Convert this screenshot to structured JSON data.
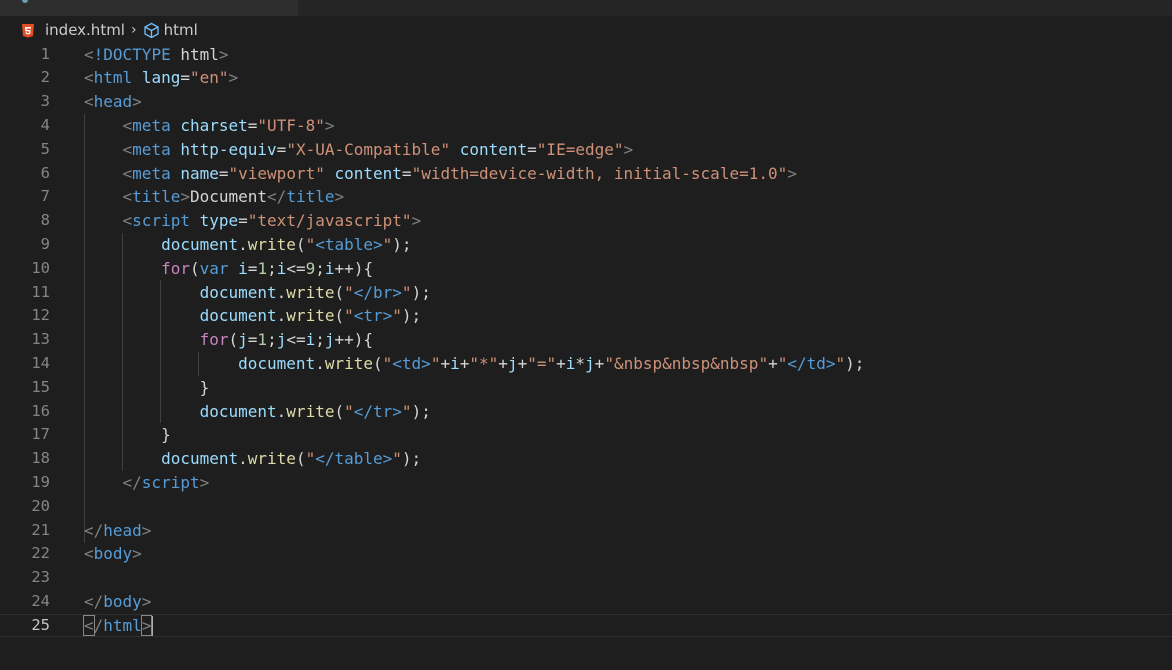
{
  "breadcrumb": {
    "file": "index.html",
    "separator": "›",
    "node": "html",
    "file_icon": "html5-icon",
    "node_icon": "cube-icon"
  },
  "editor": {
    "line_numbers": [
      "1",
      "2",
      "3",
      "4",
      "5",
      "6",
      "7",
      "8",
      "9",
      "10",
      "11",
      "12",
      "13",
      "14",
      "15",
      "16",
      "17",
      "18",
      "19",
      "20",
      "21",
      "22",
      "23",
      "24",
      "25"
    ],
    "current_line": "25",
    "colors": {
      "background": "#1e1e1e",
      "tag": "#569cd6",
      "attribute": "#9cdcfe",
      "string": "#ce9178",
      "function": "#dcdcaa",
      "keyword": "#c586c0"
    },
    "lines": [
      [
        [
          "punc",
          "<"
        ],
        [
          "tag",
          "!DOCTYPE"
        ],
        [
          "text",
          " html"
        ],
        [
          "punc",
          ">"
        ]
      ],
      [
        [
          "punc",
          "<"
        ],
        [
          "tag",
          "html"
        ],
        [
          "text",
          " "
        ],
        [
          "attr",
          "lang"
        ],
        [
          "text",
          "="
        ],
        [
          "str",
          "\"en\""
        ],
        [
          "punc",
          ">"
        ]
      ],
      [
        [
          "punc",
          "<"
        ],
        [
          "tag",
          "head"
        ],
        [
          "punc",
          ">"
        ]
      ],
      [
        [
          "text",
          "    "
        ],
        [
          "punc",
          "<"
        ],
        [
          "tag",
          "meta"
        ],
        [
          "text",
          " "
        ],
        [
          "attr",
          "charset"
        ],
        [
          "text",
          "="
        ],
        [
          "str",
          "\"UTF-8\""
        ],
        [
          "punc",
          ">"
        ]
      ],
      [
        [
          "text",
          "    "
        ],
        [
          "punc",
          "<"
        ],
        [
          "tag",
          "meta"
        ],
        [
          "text",
          " "
        ],
        [
          "attr",
          "http-equiv"
        ],
        [
          "text",
          "="
        ],
        [
          "str",
          "\"X-UA-Compatible\""
        ],
        [
          "text",
          " "
        ],
        [
          "attr",
          "content"
        ],
        [
          "text",
          "="
        ],
        [
          "str",
          "\"IE=edge\""
        ],
        [
          "punc",
          ">"
        ]
      ],
      [
        [
          "text",
          "    "
        ],
        [
          "punc",
          "<"
        ],
        [
          "tag",
          "meta"
        ],
        [
          "text",
          " "
        ],
        [
          "attr",
          "name"
        ],
        [
          "text",
          "="
        ],
        [
          "str",
          "\"viewport\""
        ],
        [
          "text",
          " "
        ],
        [
          "attr",
          "content"
        ],
        [
          "text",
          "="
        ],
        [
          "str",
          "\"width=device-width, initial-scale=1.0\""
        ],
        [
          "punc",
          ">"
        ]
      ],
      [
        [
          "text",
          "    "
        ],
        [
          "punc",
          "<"
        ],
        [
          "tag",
          "title"
        ],
        [
          "punc",
          ">"
        ],
        [
          "text",
          "Document"
        ],
        [
          "punc",
          "</"
        ],
        [
          "tag",
          "title"
        ],
        [
          "punc",
          ">"
        ]
      ],
      [
        [
          "text",
          "    "
        ],
        [
          "punc",
          "<"
        ],
        [
          "tag",
          "script"
        ],
        [
          "text",
          " "
        ],
        [
          "attr",
          "type"
        ],
        [
          "text",
          "="
        ],
        [
          "str",
          "\"text/javascript\""
        ],
        [
          "punc",
          ">"
        ]
      ],
      [
        [
          "text",
          "        "
        ],
        [
          "var",
          "document"
        ],
        [
          "text",
          "."
        ],
        [
          "fn",
          "write"
        ],
        [
          "text",
          "("
        ],
        [
          "str",
          "\""
        ],
        [
          "tag",
          "<table>"
        ],
        [
          "str",
          "\""
        ],
        [
          "text",
          ");"
        ]
      ],
      [
        [
          "text",
          "        "
        ],
        [
          "kw",
          "for"
        ],
        [
          "text",
          "("
        ],
        [
          "stor",
          "var"
        ],
        [
          "text",
          " "
        ],
        [
          "var",
          "i"
        ],
        [
          "text",
          "="
        ],
        [
          "num",
          "1"
        ],
        [
          "text",
          ";"
        ],
        [
          "var",
          "i"
        ],
        [
          "text",
          "<="
        ],
        [
          "num",
          "9"
        ],
        [
          "text",
          ";"
        ],
        [
          "var",
          "i"
        ],
        [
          "text",
          "++){"
        ]
      ],
      [
        [
          "text",
          "            "
        ],
        [
          "var",
          "document"
        ],
        [
          "text",
          "."
        ],
        [
          "fn",
          "write"
        ],
        [
          "text",
          "("
        ],
        [
          "str",
          "\""
        ],
        [
          "tag",
          "</br>"
        ],
        [
          "str",
          "\""
        ],
        [
          "text",
          ");"
        ]
      ],
      [
        [
          "text",
          "            "
        ],
        [
          "var",
          "document"
        ],
        [
          "text",
          "."
        ],
        [
          "fn",
          "write"
        ],
        [
          "text",
          "("
        ],
        [
          "str",
          "\""
        ],
        [
          "tag",
          "<tr>"
        ],
        [
          "str",
          "\""
        ],
        [
          "text",
          ");"
        ]
      ],
      [
        [
          "text",
          "            "
        ],
        [
          "kw",
          "for"
        ],
        [
          "text",
          "("
        ],
        [
          "var",
          "j"
        ],
        [
          "text",
          "="
        ],
        [
          "num",
          "1"
        ],
        [
          "text",
          ";"
        ],
        [
          "var",
          "j"
        ],
        [
          "text",
          "<="
        ],
        [
          "var",
          "i"
        ],
        [
          "text",
          ";"
        ],
        [
          "var",
          "j"
        ],
        [
          "text",
          "++){"
        ]
      ],
      [
        [
          "text",
          "                "
        ],
        [
          "var",
          "document"
        ],
        [
          "text",
          "."
        ],
        [
          "fn",
          "write"
        ],
        [
          "text",
          "("
        ],
        [
          "str",
          "\""
        ],
        [
          "tag",
          "<td>"
        ],
        [
          "str",
          "\""
        ],
        [
          "text",
          "+"
        ],
        [
          "var",
          "i"
        ],
        [
          "text",
          "+"
        ],
        [
          "str",
          "\"*\""
        ],
        [
          "text",
          "+"
        ],
        [
          "var",
          "j"
        ],
        [
          "text",
          "+"
        ],
        [
          "str",
          "\"=\""
        ],
        [
          "text",
          "+"
        ],
        [
          "var",
          "i"
        ],
        [
          "text",
          "*"
        ],
        [
          "var",
          "j"
        ],
        [
          "text",
          "+"
        ],
        [
          "str",
          "\"&nbsp&nbsp&nbsp\""
        ],
        [
          "text",
          "+"
        ],
        [
          "str",
          "\""
        ],
        [
          "tag",
          "</td>"
        ],
        [
          "str",
          "\""
        ],
        [
          "text",
          ");"
        ]
      ],
      [
        [
          "text",
          "            }"
        ]
      ],
      [
        [
          "text",
          "            "
        ],
        [
          "var",
          "document"
        ],
        [
          "text",
          "."
        ],
        [
          "fn",
          "write"
        ],
        [
          "text",
          "("
        ],
        [
          "str",
          "\""
        ],
        [
          "tag",
          "</tr>"
        ],
        [
          "str",
          "\""
        ],
        [
          "text",
          ");"
        ]
      ],
      [
        [
          "text",
          "        }"
        ]
      ],
      [
        [
          "text",
          "        "
        ],
        [
          "var",
          "document"
        ],
        [
          "text",
          "."
        ],
        [
          "fn",
          "write"
        ],
        [
          "text",
          "("
        ],
        [
          "str",
          "\""
        ],
        [
          "tag",
          "</table>"
        ],
        [
          "str",
          "\""
        ],
        [
          "text",
          ");"
        ]
      ],
      [
        [
          "text",
          "    "
        ],
        [
          "punc",
          "</"
        ],
        [
          "tag",
          "script"
        ],
        [
          "punc",
          ">"
        ]
      ],
      [],
      [
        [
          "punc",
          "</"
        ],
        [
          "tag",
          "head"
        ],
        [
          "punc",
          ">"
        ]
      ],
      [
        [
          "punc",
          "<"
        ],
        [
          "tag",
          "body"
        ],
        [
          "punc",
          ">"
        ]
      ],
      [],
      [
        [
          "punc",
          "</"
        ],
        [
          "tag",
          "body"
        ],
        [
          "punc",
          ">"
        ]
      ],
      [
        [
          "hl",
          "<"
        ],
        [
          "punc",
          "/"
        ],
        [
          "tag",
          "html"
        ],
        [
          "hl",
          ">"
        ],
        [
          "cursor",
          ""
        ]
      ]
    ]
  }
}
